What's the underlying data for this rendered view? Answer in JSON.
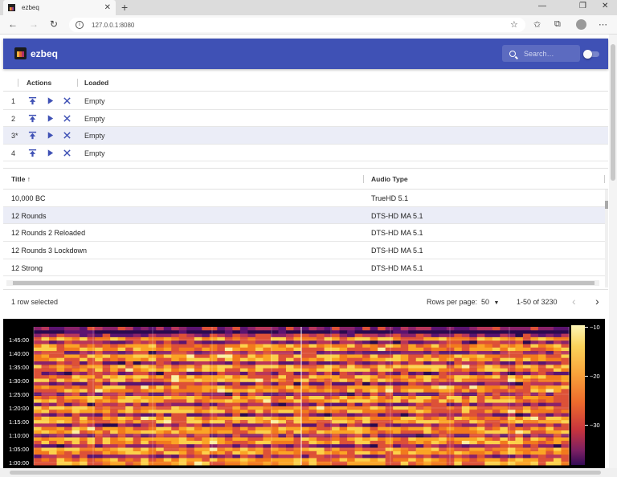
{
  "browser": {
    "tab_title": "ezbeq",
    "tab_close": "✕",
    "new_tab": "+",
    "url": "127.0.0.1:8080",
    "window_controls": [
      "—",
      "❐",
      "✕"
    ]
  },
  "app": {
    "title": "ezbeq",
    "search_placeholder": "Search…",
    "dark_mode_toggle": false,
    "accent_color": "#3f51b5"
  },
  "devices": {
    "headers": {
      "actions": "Actions",
      "loaded": "Loaded"
    },
    "rows": [
      {
        "slot": "1",
        "loaded": "Empty"
      },
      {
        "slot": "2",
        "loaded": "Empty"
      },
      {
        "slot": "3*",
        "loaded": "Empty"
      },
      {
        "slot": "4",
        "loaded": "Empty"
      }
    ]
  },
  "catalogue": {
    "headers": {
      "title": "Title",
      "sort_arrow": "↑",
      "audio": "Audio Type"
    },
    "rows": [
      {
        "title": "10,000 BC",
        "audio": "TrueHD 5.1"
      },
      {
        "title": "12 Rounds",
        "audio": "DTS-HD MA 5.1"
      },
      {
        "title": "12 Rounds 2 Reloaded",
        "audio": "DTS-HD MA 5.1"
      },
      {
        "title": "12 Rounds 3 Lockdown",
        "audio": "DTS-HD MA 5.1"
      },
      {
        "title": "12 Strong",
        "audio": "DTS-HD MA 5.1"
      }
    ],
    "footer": {
      "selected": "1 row selected",
      "rows_per_page_label": "Rows per page:",
      "rows_per_page": "50",
      "range": "1-50 of 3230",
      "prev": "‹",
      "next": "›"
    }
  },
  "spectrogram": {
    "y_ticks": [
      "1:45:00",
      "1:40:00",
      "1:35:00",
      "1:30:00",
      "1:25:00",
      "1:20:00",
      "1:15:00",
      "1:10:00",
      "1:05:00",
      "1:00:00"
    ],
    "colorbar_ticks": [
      "−10",
      "−20",
      "−30"
    ]
  }
}
